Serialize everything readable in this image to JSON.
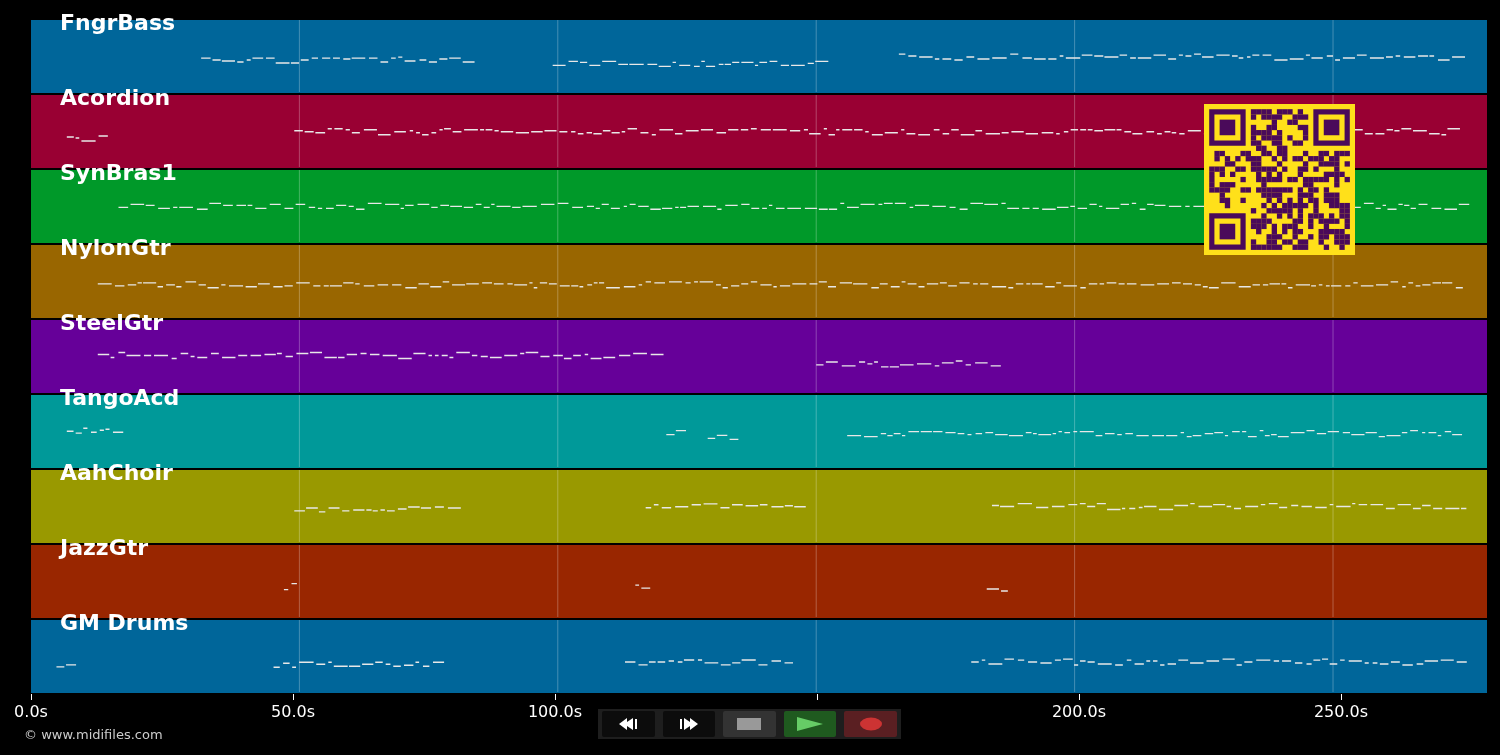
{
  "tracks": [
    {
      "name": "FngrBass",
      "color": "#00669a"
    },
    {
      "name": "Acordion",
      "color": "#990033"
    },
    {
      "name": "SynBras1",
      "color": "#009929"
    },
    {
      "name": "NylonGtr",
      "color": "#996600"
    },
    {
      "name": "SteelGtr",
      "color": "#660099"
    },
    {
      "name": "TangoAcd",
      "color": "#009999"
    },
    {
      "name": "AahChoir",
      "color": "#999900"
    },
    {
      "name": "JazzGtr",
      "color": "#992600"
    },
    {
      "name": "GM Drums",
      "color": "#00669a"
    }
  ],
  "time_axis": {
    "ticks": [
      "0.0s",
      "50.0s",
      "100.0s",
      "200.0s",
      "250.0s"
    ]
  },
  "transport": [
    {
      "kind": "rewind"
    },
    {
      "kind": "forward"
    },
    {
      "kind": "stop"
    },
    {
      "kind": "play"
    },
    {
      "kind": "record"
    }
  ],
  "credit": "© www.midifiles.com"
}
